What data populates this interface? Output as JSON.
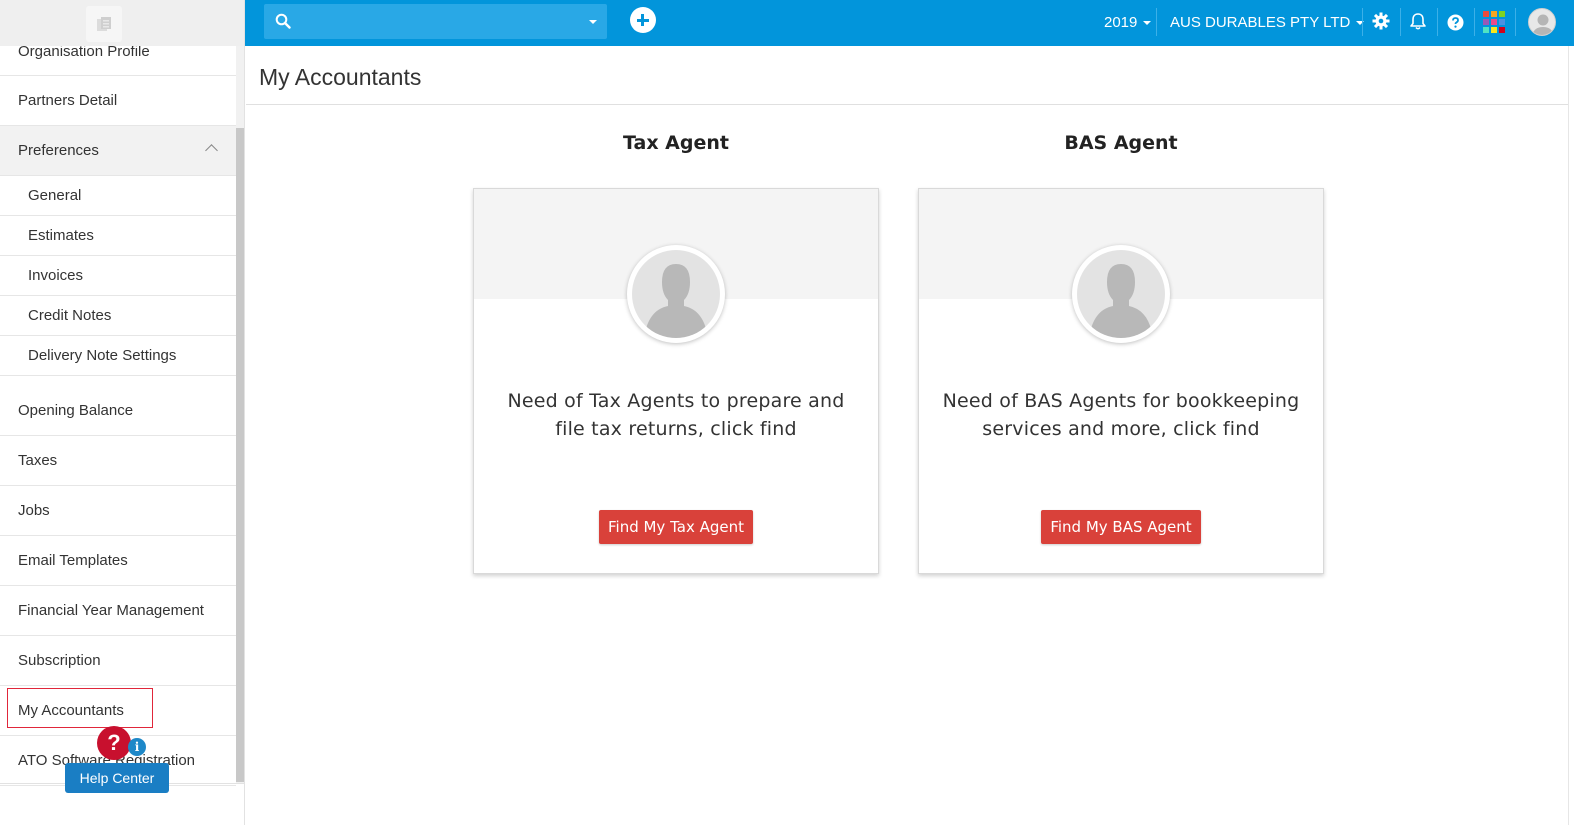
{
  "sidebar": {
    "items": [
      {
        "label": "Organisation Profile"
      },
      {
        "label": "Partners Detail"
      },
      {
        "label": "Preferences"
      },
      {
        "label": "Opening Balance"
      },
      {
        "label": "Taxes"
      },
      {
        "label": "Jobs"
      },
      {
        "label": "Email Templates"
      },
      {
        "label": "Financial Year Management"
      },
      {
        "label": "Subscription"
      },
      {
        "label": "My Accountants"
      },
      {
        "label": "ATO Software Registration"
      }
    ],
    "preferences_subitems": [
      {
        "label": "General"
      },
      {
        "label": "Estimates"
      },
      {
        "label": "Invoices"
      },
      {
        "label": "Credit Notes"
      },
      {
        "label": "Delivery Note Settings"
      }
    ]
  },
  "help": {
    "bubble": "?",
    "info": "i",
    "label": "Help Center"
  },
  "topbar": {
    "search_value": "",
    "year": "2019",
    "company": "AUS DURABLES PTY LTD"
  },
  "main": {
    "title": "My Accountants",
    "tax": {
      "heading": "Tax Agent",
      "text": "Need of Tax Agents to prepare and file tax returns, click find",
      "button": "Find My Tax Agent"
    },
    "bas": {
      "heading": "BAS Agent",
      "text": "Need of BAS Agents for bookkeeping services and more, click find",
      "button": "Find My BAS Agent"
    }
  },
  "colors": {
    "topbar": "#0295db",
    "search": "#29a8e6",
    "button_red": "#d9413a",
    "help_blue": "#1a7ec4",
    "highlight_red": "#e0263a"
  }
}
